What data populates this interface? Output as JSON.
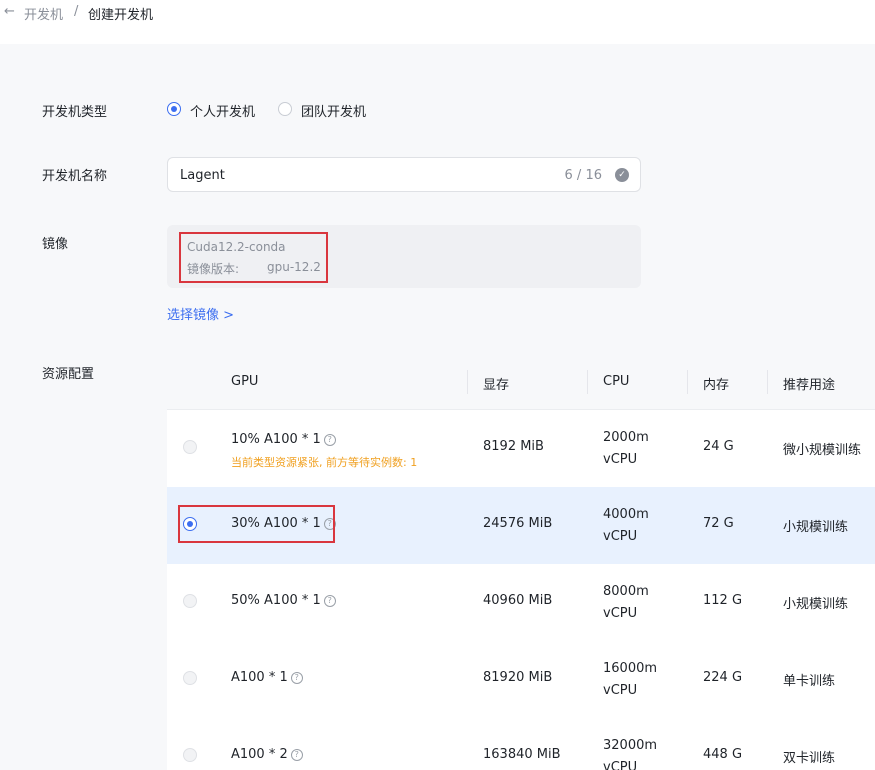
{
  "breadcrumb": {
    "back_icon": "arrow-left-icon",
    "back_glyph": "←",
    "parent": "开发机",
    "separator": "/",
    "current": "创建开发机"
  },
  "form": {
    "type": {
      "label": "开发机类型",
      "options": [
        {
          "label": "个人开发机",
          "checked": true
        },
        {
          "label": "团队开发机",
          "checked": false
        }
      ]
    },
    "name": {
      "label": "开发机名称",
      "value": "Lagent",
      "count": "6 / 16",
      "status_icon": "check-circle-icon",
      "status_glyph": "✓"
    },
    "image": {
      "label": "镜像",
      "name": "Cuda12.2-conda",
      "version_label": "镜像版本:",
      "version_value": "gpu-12.2",
      "select_link": "选择镜像 >"
    },
    "resources": {
      "label": "资源配置",
      "columns": [
        "GPU",
        "显存",
        "CPU",
        "内存",
        "推荐用途"
      ],
      "help_glyph": "?",
      "rows": [
        {
          "gpu": "10% A100 * 1",
          "warning": "当前类型资源紧张, 前方等待实例数: 1",
          "memory": "8192 MiB",
          "cpu_line1": "2000m",
          "cpu_line2": "vCPU",
          "ram": "24 G",
          "usage": "微小规模训练",
          "selected": false
        },
        {
          "gpu": "30% A100 * 1",
          "warning": "",
          "memory": "24576 MiB",
          "cpu_line1": "4000m",
          "cpu_line2": "vCPU",
          "ram": "72 G",
          "usage": "小规模训练",
          "selected": true
        },
        {
          "gpu": "50% A100 * 1",
          "warning": "",
          "memory": "40960 MiB",
          "cpu_line1": "8000m",
          "cpu_line2": "vCPU",
          "ram": "112 G",
          "usage": "小规模训练",
          "selected": false
        },
        {
          "gpu": "A100 * 1",
          "warning": "",
          "memory": "81920 MiB",
          "cpu_line1": "16000m",
          "cpu_line2": "vCPU",
          "ram": "224 G",
          "usage": "单卡训练",
          "selected": false
        },
        {
          "gpu": "A100 * 2",
          "warning": "",
          "memory": "163840 MiB",
          "cpu_line1": "32000m",
          "cpu_line2": "vCPU",
          "ram": "448 G",
          "usage": "双卡训练",
          "selected": false
        }
      ]
    }
  },
  "colors": {
    "accent": "#3c6ef0",
    "warning": "#f0a020",
    "annotation": "#d9363e"
  }
}
